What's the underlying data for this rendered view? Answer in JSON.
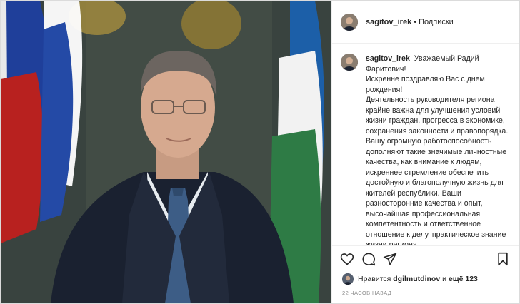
{
  "header": {
    "username": "sagitov_irek",
    "separator": "•",
    "follow_label": "Подписки"
  },
  "caption": {
    "username": "sagitov_irek",
    "lines": [
      "Уважаемый Радий Фаритович!",
      "Искренне поздравляю Вас с днем рождения!",
      "Деятельность руководителя региона крайне важна для улучшения условий жизни граждан, прогресса в экономике, сохранения законности и правопорядка. Вашу огромную работоспособность дополняют такие значимые личностные качества, как внимание к людям, искреннее стремление обеспечить достойную и благополучную жизнь для жителей республики. Ваши разносторонние качества и опыт, высочайшая профессиональная компетентность и ответственное отношение к делу, практическое знание жизни региона"
    ]
  },
  "actions": {
    "like_icon": "heart-icon",
    "comment_icon": "comment-icon",
    "share_icon": "paper-plane-icon",
    "save_icon": "bookmark-icon"
  },
  "likes": {
    "prefix": "Нравится",
    "user": "dgilmutdinov",
    "connector": "и",
    "others": "ещё 123"
  },
  "timestamp": "22 часов назад"
}
